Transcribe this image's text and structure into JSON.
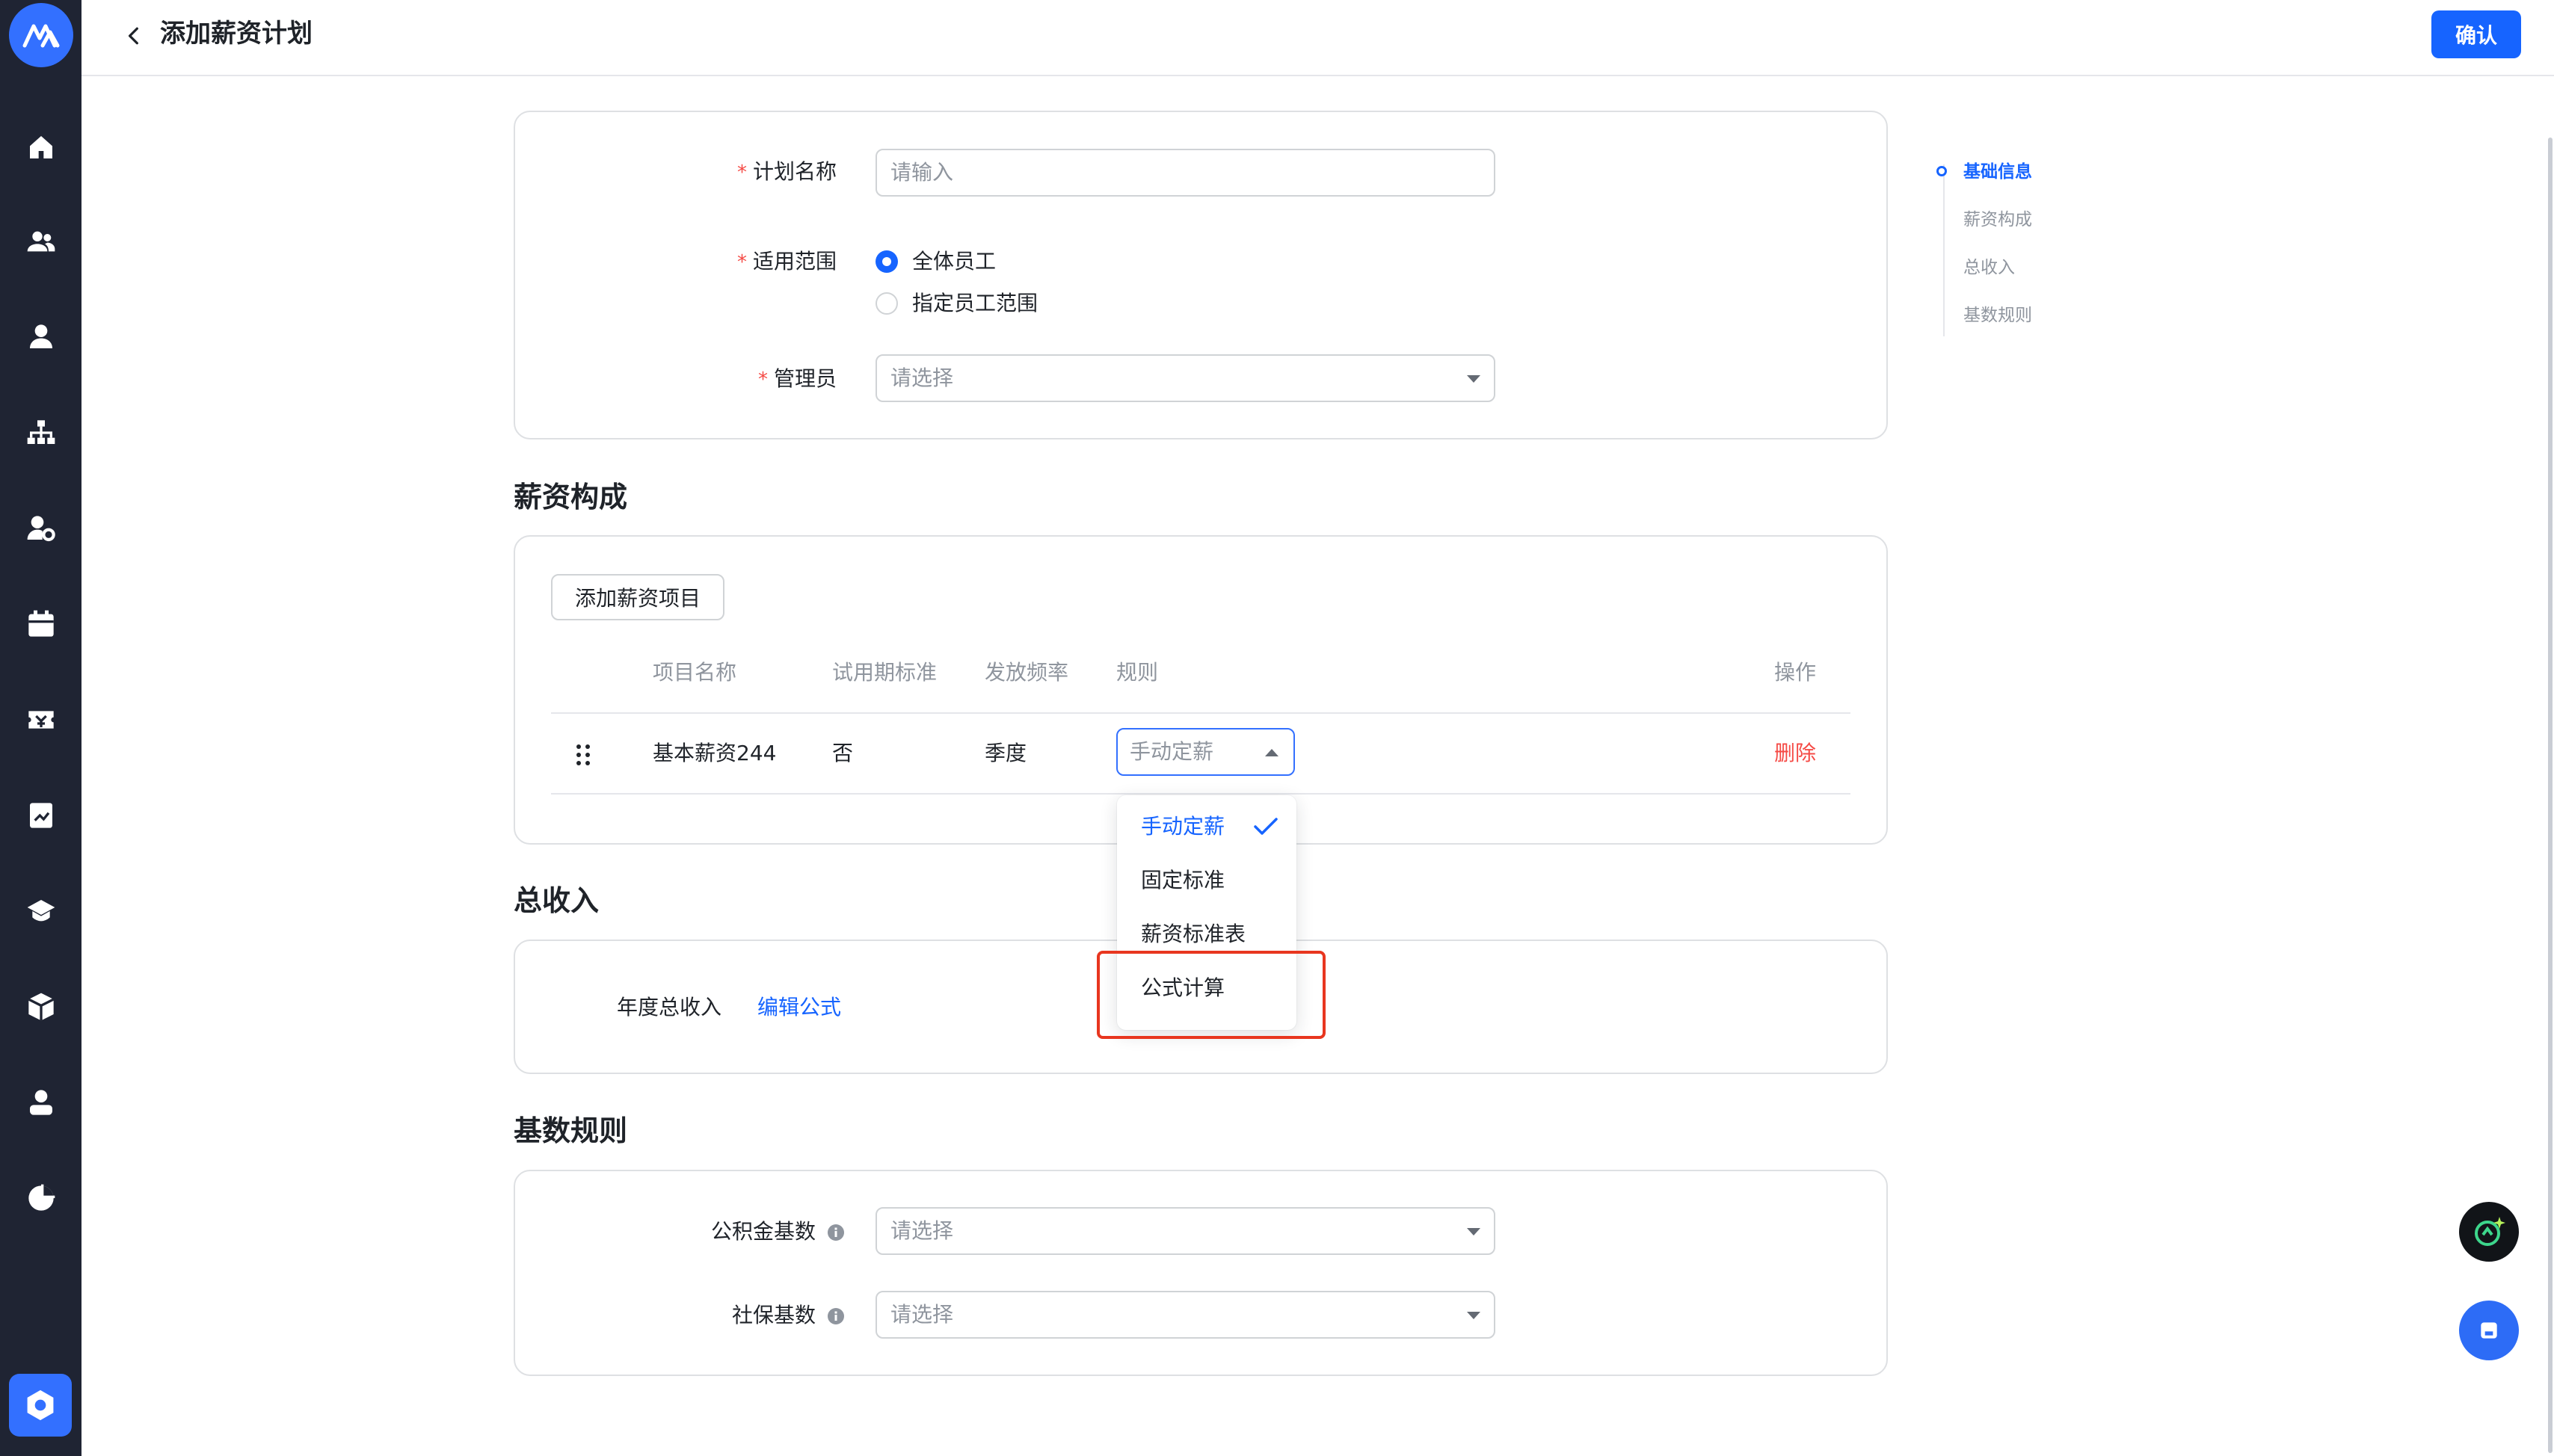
{
  "header": {
    "title": "添加薪资计划",
    "confirm_label": "确认"
  },
  "sidebar": {
    "items": [
      "home-icon",
      "people-icon",
      "person-icon",
      "org-chart-icon",
      "person-settings-icon",
      "calendar-icon",
      "ticket-icon",
      "report-icon",
      "graduation-icon",
      "box-icon",
      "profile-icon",
      "pie-chart-icon"
    ],
    "bottom_item": "settings-icon"
  },
  "basic_info": {
    "plan_name_label": "计划名称",
    "plan_name_placeholder": "请输入",
    "scope_label": "适用范围",
    "scope_options": [
      "全体员工",
      "指定员工范围"
    ],
    "scope_selected": "全体员工",
    "admin_label": "管理员",
    "admin_placeholder": "请选择"
  },
  "salary_structure": {
    "title": "薪资构成",
    "add_button": "添加薪资项目",
    "columns": [
      "项目名称",
      "试用期标准",
      "发放频率",
      "规则",
      "操作"
    ],
    "rows": [
      {
        "name": "基本薪资244",
        "probation": "否",
        "frequency": "季度",
        "rule": "手动定薪",
        "action": "删除"
      }
    ],
    "rule_dropdown": {
      "options": [
        "手动定薪",
        "固定标准",
        "薪资标准表",
        "公式计算"
      ],
      "selected": "手动定薪",
      "highlighted": "公式计算"
    }
  },
  "total_income": {
    "title": "总收入",
    "annual_label": "年度总收入",
    "edit_formula": "编辑公式"
  },
  "base_rules": {
    "title": "基数规则",
    "housing_fund_label": "公积金基数",
    "housing_fund_placeholder": "请选择",
    "social_security_label": "社保基数",
    "social_security_placeholder": "请选择"
  },
  "anchor_nav": {
    "items": [
      "基础信息",
      "薪资构成",
      "总收入",
      "基数规则"
    ],
    "active": "基础信息"
  },
  "colors": {
    "primary": "#1664ff",
    "danger": "#f54a45",
    "sidebar_bg": "#1f2433",
    "highlight_border": "#e8361f"
  }
}
